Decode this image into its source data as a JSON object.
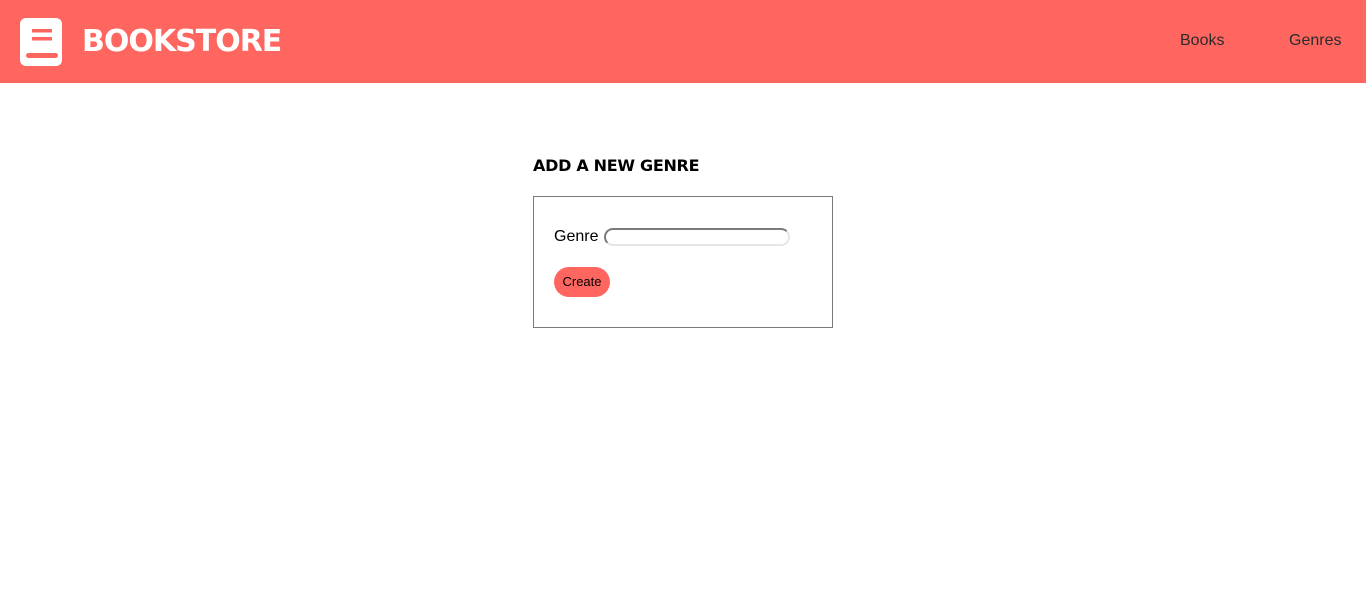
{
  "colors": {
    "brand": "#ff6660",
    "header_text": "#ffffff",
    "nav_text": "#2b2b2b"
  },
  "header": {
    "logo_icon": "book-icon",
    "brand": "BOOKSTORE",
    "nav": {
      "books": "Books",
      "genres": "Genres"
    }
  },
  "main": {
    "title": "ADD A NEW GENRE",
    "form": {
      "genre_label": "Genre",
      "genre_value": "",
      "create_label": "Create"
    }
  }
}
